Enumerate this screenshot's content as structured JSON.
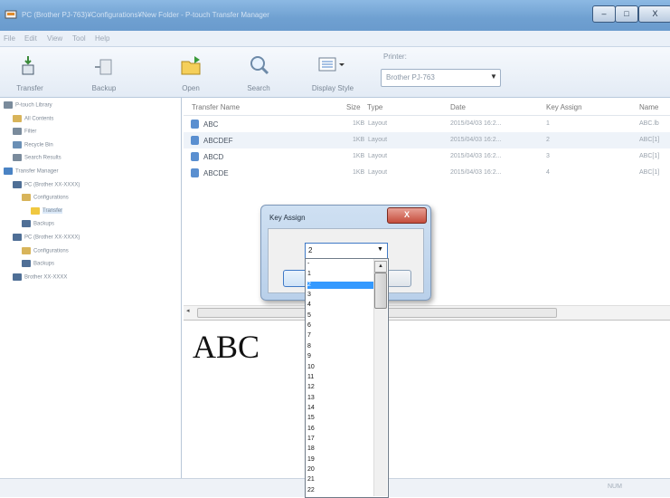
{
  "window": {
    "title": "PC (Brother PJ-763)¥Configurations¥New Folder - P-touch Transfer Manager",
    "controls": {
      "minimize": "–",
      "maximize": "□",
      "close": "X"
    }
  },
  "menu": [
    "File",
    "Edit",
    "View",
    "Tool",
    "Help"
  ],
  "toolbar": {
    "transfer": "Transfer",
    "backup": "Backup",
    "open": "Open",
    "search": "Search",
    "display_style": "Display Style",
    "printer_label": "Printer:",
    "printer_value": "Brother PJ-763"
  },
  "tree": [
    {
      "label": "P-touch Library",
      "level": 0
    },
    {
      "label": "All Contents",
      "level": 1
    },
    {
      "label": "Filter",
      "level": 1
    },
    {
      "label": "Recycle Bin",
      "level": 1
    },
    {
      "label": "Search Results",
      "level": 1
    },
    {
      "label": "Transfer Manager",
      "level": 0
    },
    {
      "label": "PC (Brother XX-XXXX)",
      "level": 1
    },
    {
      "label": "Configurations",
      "level": 2
    },
    {
      "label": "Transfer",
      "level": 3
    },
    {
      "label": "Backups",
      "level": 2
    },
    {
      "label": "PC (Brother XX-XXXX)",
      "level": 1
    },
    {
      "label": "Configurations",
      "level": 2
    },
    {
      "label": "Backups",
      "level": 2
    },
    {
      "label": "Brother XX-XXXX",
      "level": 1
    }
  ],
  "list": {
    "columns": [
      "Transfer Name",
      "Size",
      "Type",
      "Date",
      "Key Assign",
      "Name"
    ],
    "rows": [
      {
        "name": "ABC",
        "size": "1KB",
        "type": "Layout",
        "date": "2015/04/03 16:2...",
        "key": "1",
        "label": "ABC.lb"
      },
      {
        "name": "ABCDEF",
        "size": "1KB",
        "type": "Layout",
        "date": "2015/04/03 16:2...",
        "key": "2",
        "label": "ABC[1]"
      },
      {
        "name": "ABCD",
        "size": "1KB",
        "type": "Layout",
        "date": "2015/04/03 16:2...",
        "key": "3",
        "label": "ABC[1]"
      },
      {
        "name": "ABCDE",
        "size": "1KB",
        "type": "Layout",
        "date": "2015/04/03 16:2...",
        "key": "4",
        "label": "ABC[1]"
      }
    ]
  },
  "preview": {
    "text": "ABC"
  },
  "status": {
    "num": "NUM"
  },
  "dialog": {
    "title": "Key Assign",
    "close": "X",
    "selected": "2",
    "ok": "OK",
    "cancel": "Cancel",
    "options": [
      "-",
      "1",
      "2",
      "3",
      "4",
      "5",
      "6",
      "7",
      "8",
      "9",
      "10",
      "11",
      "12",
      "13",
      "14",
      "15",
      "16",
      "17",
      "18",
      "19",
      "20",
      "21",
      "22"
    ],
    "selected_index": 2
  }
}
